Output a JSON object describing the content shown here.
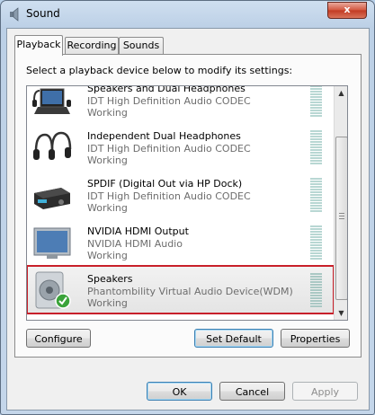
{
  "window": {
    "title": "Sound",
    "close_label": "x"
  },
  "tabs": [
    {
      "label": "Playback",
      "active": true
    },
    {
      "label": "Recording",
      "active": false
    },
    {
      "label": "Sounds",
      "active": false
    }
  ],
  "playback": {
    "instruction": "Select a playback device below to modify its settings:",
    "devices": [
      {
        "name": "Speakers and Dual Headphones",
        "description": "IDT High Definition Audio CODEC",
        "status": "Working",
        "icon": "laptop-headphones-icon"
      },
      {
        "name": "Independent Dual Headphones",
        "description": "IDT High Definition Audio CODEC",
        "status": "Working",
        "icon": "headphones-icon"
      },
      {
        "name": "SPDIF (Digital Out via HP Dock)",
        "description": "IDT High Definition Audio CODEC",
        "status": "Working",
        "icon": "spdif-receiver-icon"
      },
      {
        "name": "NVIDIA HDMI Output",
        "description": "NVIDIA HDMI Audio",
        "status": "Working",
        "icon": "hdmi-monitor-icon"
      },
      {
        "name": "Speakers",
        "description": "Phantombility Virtual Audio Device(WDM)",
        "status": "Working",
        "icon": "speaker-default-icon",
        "selected": true
      }
    ],
    "configure_label": "Configure",
    "set_default_label": "Set Default",
    "properties_label": "Properties"
  },
  "dialog_buttons": {
    "ok": "OK",
    "cancel": "Cancel",
    "apply": "Apply"
  },
  "colors": {
    "selection_border": "#c8202a",
    "default_check": "#3aa33a"
  }
}
